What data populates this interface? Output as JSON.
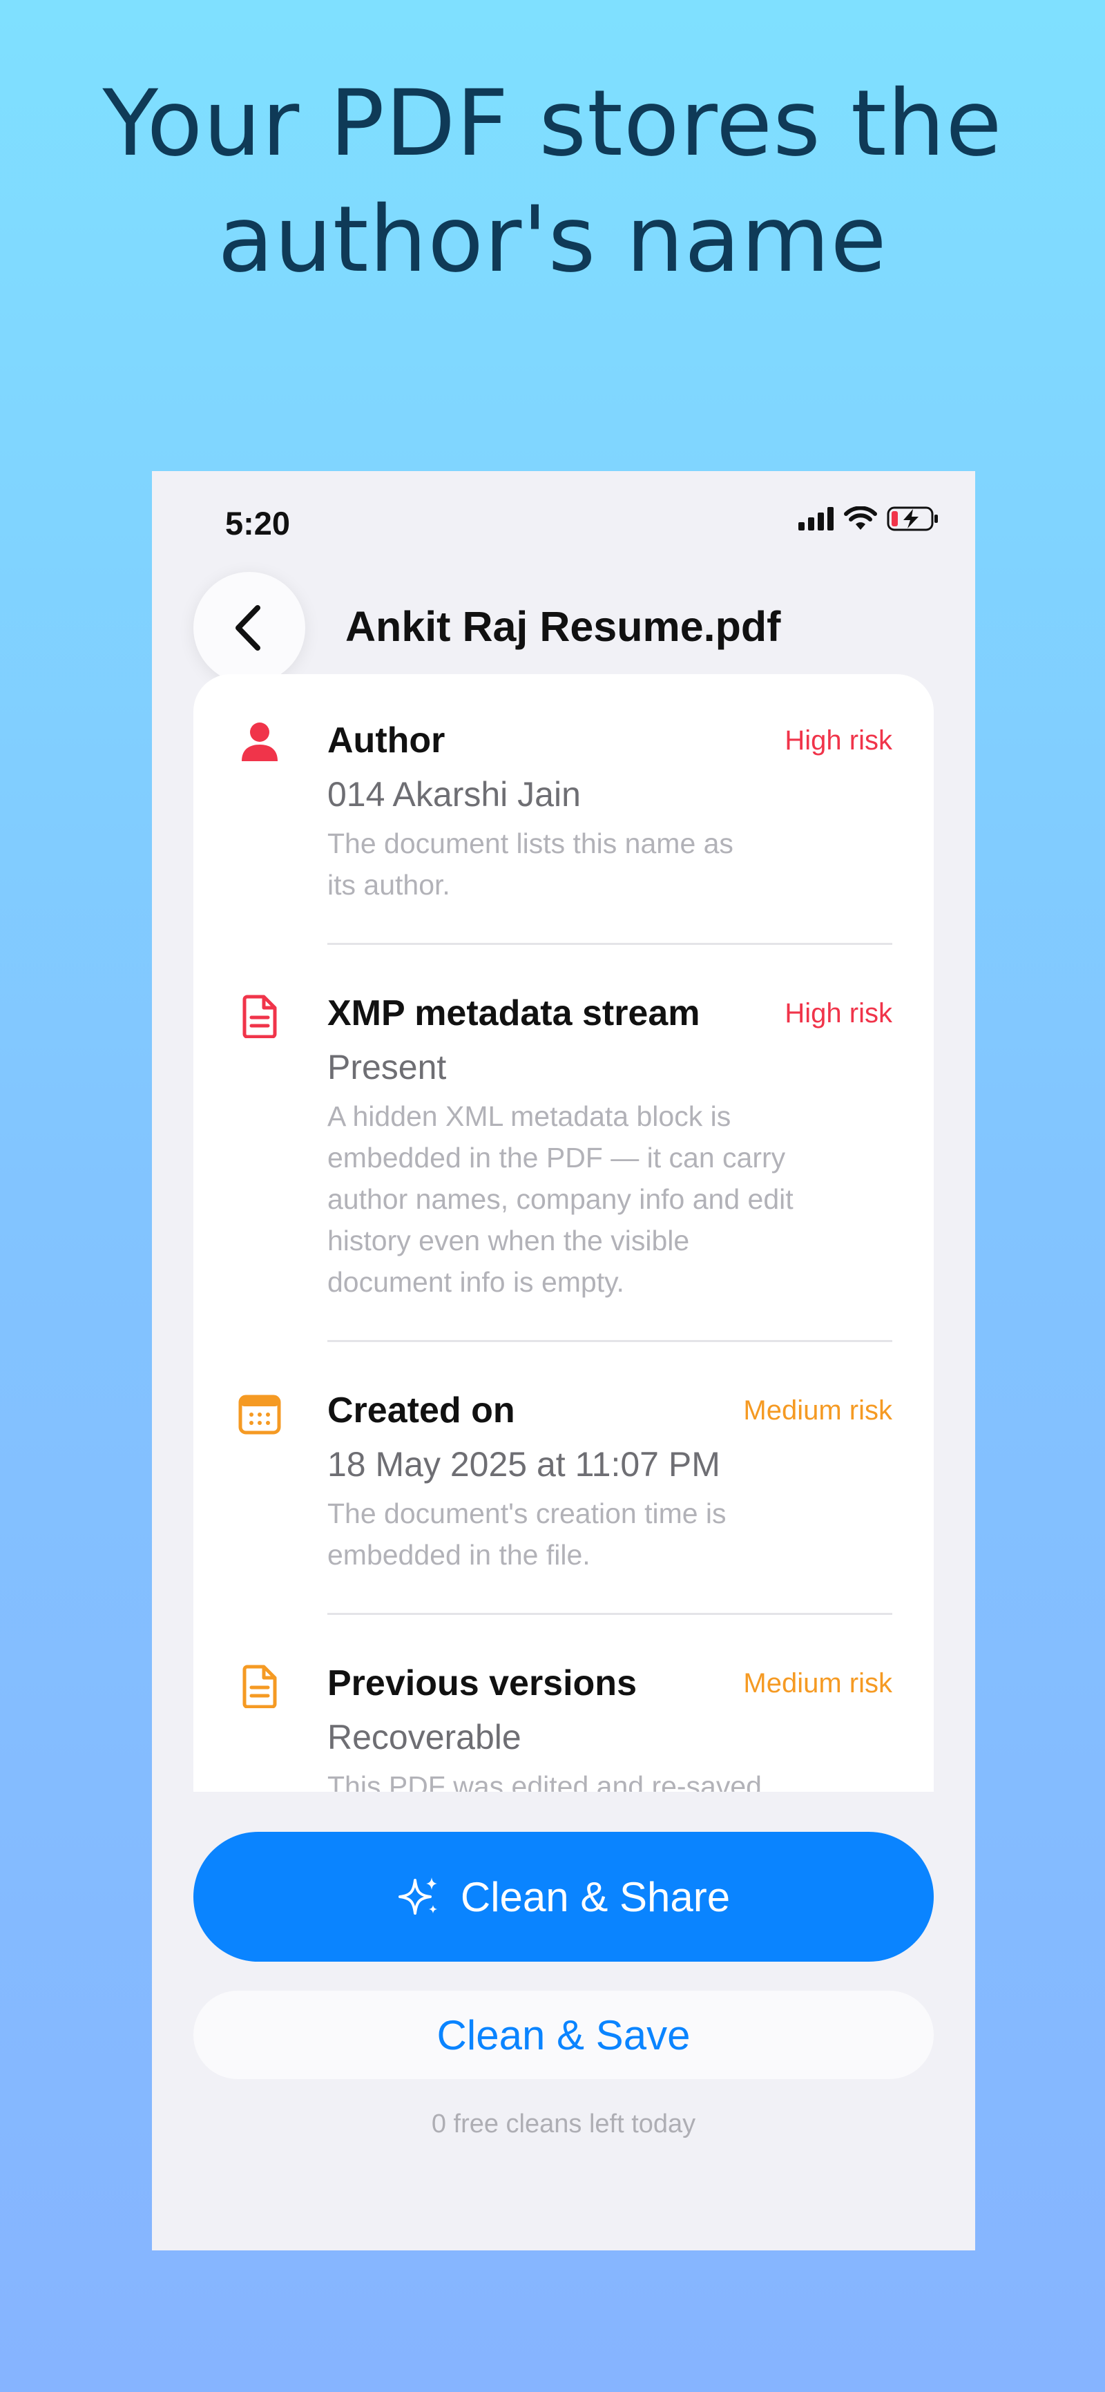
{
  "headline": {
    "line1": "Your PDF stores the",
    "line2": "author's name"
  },
  "status_bar": {
    "time": "5:20",
    "icons": [
      "signal-icon",
      "wifi-icon",
      "battery-charging-icon"
    ]
  },
  "nav": {
    "back_icon": "chevron-left-icon",
    "title": "Ankit Raj Resume.pdf"
  },
  "items": [
    {
      "icon": "person-icon",
      "icon_color": "#f0344a",
      "title": "Author",
      "risk": "High risk",
      "risk_level": "high",
      "value": "014 Akarshi Jain",
      "description": [
        "The document lists this name as",
        "its author."
      ]
    },
    {
      "icon": "document-icon",
      "icon_color": "#f0344a",
      "title": "XMP metadata stream",
      "risk": "High risk",
      "risk_level": "high",
      "value": "Present",
      "description": [
        "A hidden XML metadata block is",
        "embedded in the PDF — it can carry",
        "author names, company info and edit",
        "history even when the visible",
        "document info is empty."
      ]
    },
    {
      "icon": "calendar-icon",
      "icon_color": "#f59a23",
      "title": "Created on",
      "risk": "Medium risk",
      "risk_level": "medium",
      "value": "18 May 2025 at 11:07 PM",
      "description": [
        "The document's creation time is",
        "embedded in the file."
      ]
    },
    {
      "icon": "document-icon",
      "icon_color": "#f59a23",
      "title": "Previous versions",
      "risk": "Medium risk",
      "risk_level": "medium",
      "value": "Recoverable",
      "description": [
        "This PDF was edited and re-saved"
      ]
    }
  ],
  "actions": {
    "share_icon": "sparkles-icon",
    "share_label": "Clean & Share",
    "save_label": "Clean & Save"
  },
  "footnote": "0 free cleans left today",
  "colors": {
    "accent": "#0a84ff",
    "high_risk": "#f0344a",
    "medium_risk": "#f59a23"
  }
}
